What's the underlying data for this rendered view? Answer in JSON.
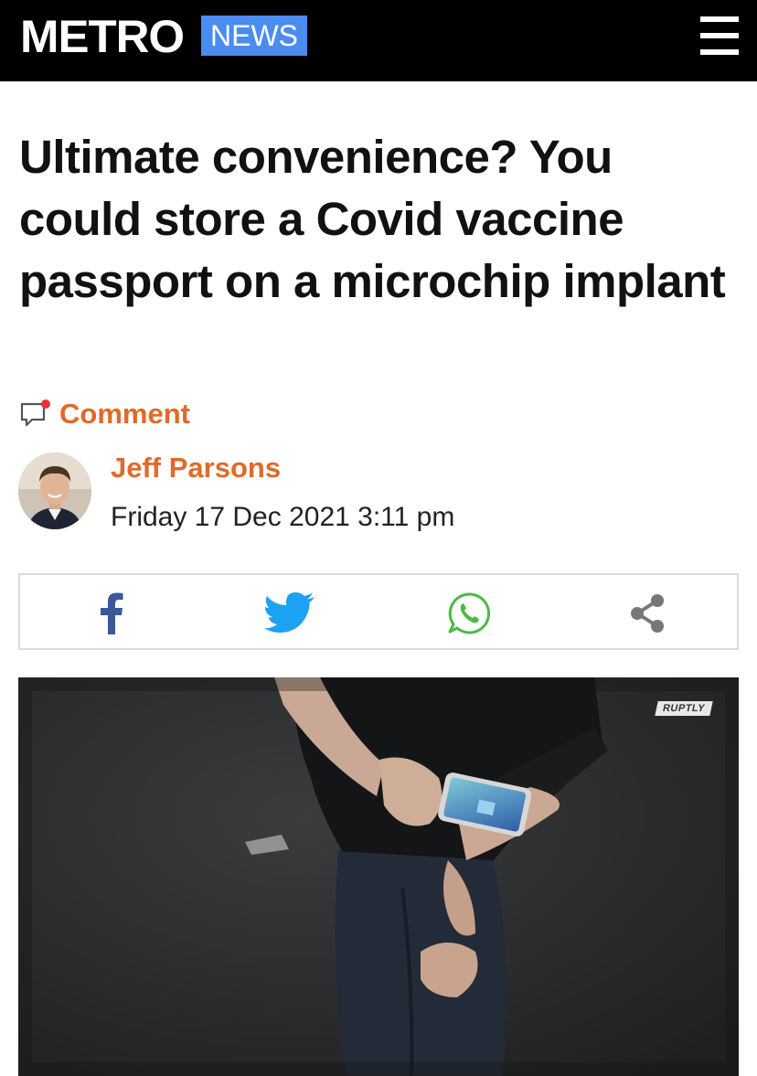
{
  "header": {
    "logo_text": "METRO",
    "section_label": "NEWS",
    "menu_icon": "hamburger-menu-icon",
    "section_color": "#4a8cf0"
  },
  "article": {
    "headline": "Ultimate convenience? You could store a Covid vaccine passport on a microchip implant",
    "comment_label": "Comment",
    "author": "Jeff Parsons",
    "published": "Friday 17 Dec 2021 3:11 pm",
    "accent_color": "#e06a28"
  },
  "share": {
    "buttons": [
      {
        "network": "Facebook",
        "icon": "facebook-icon",
        "color": "#3b5998"
      },
      {
        "network": "Twitter",
        "icon": "twitter-icon",
        "color": "#1da1f2"
      },
      {
        "network": "WhatsApp",
        "icon": "whatsapp-icon",
        "color": "#4cb944"
      },
      {
        "network": "Share",
        "icon": "share-icon",
        "color": "#777777"
      }
    ]
  },
  "hero_image": {
    "watermark": "RUPTLY"
  }
}
